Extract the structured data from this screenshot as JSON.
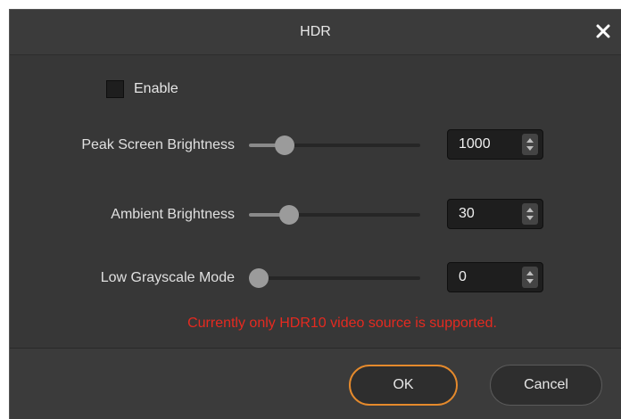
{
  "dialog": {
    "title": "HDR",
    "close_icon": "close-icon"
  },
  "enable": {
    "label": "Enable",
    "checked": false
  },
  "settings": [
    {
      "label": "Peak Screen Brightness",
      "value": "1000",
      "slider_fraction": 0.17
    },
    {
      "label": "Ambient Brightness",
      "value": "30",
      "slider_fraction": 0.2
    },
    {
      "label": "Low Grayscale Mode",
      "value": "0",
      "slider_fraction": 0.0
    }
  ],
  "notice": {
    "text": "Currently only HDR10 video source is supported.",
    "color": "#e52a20"
  },
  "footer": {
    "ok_label": "OK",
    "cancel_label": "Cancel"
  },
  "colors": {
    "background": "#373737",
    "ok_border": "#e58a2c"
  }
}
